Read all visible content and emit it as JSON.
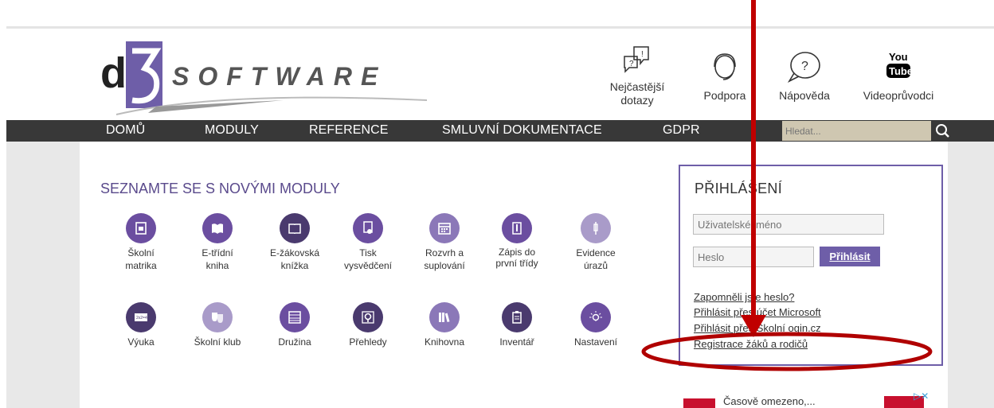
{
  "header": {
    "logo_text": "SOFTWARE",
    "quick_links": [
      {
        "label": "Nejčastější dotazy",
        "icon": "faq-bubbles-icon"
      },
      {
        "label": "Podpora",
        "icon": "headset-icon"
      },
      {
        "label": "Nápověda",
        "icon": "help-bubble-icon"
      },
      {
        "label": "Videoprůvodci",
        "icon": "youtube-icon"
      }
    ]
  },
  "nav": {
    "items": [
      "DOMŮ",
      "MODULY",
      "REFERENCE",
      "SMLUVNÍ DOKUMENTACE",
      "GDPR"
    ],
    "search_placeholder": "Hledat..."
  },
  "modules": {
    "title": "SEZNAMTE SE S NOVÝMI MODULY",
    "row1": [
      {
        "label": "Školní matrika",
        "color": "#6b4ea0"
      },
      {
        "label": "E-třídní kniha",
        "color": "#6b4ea0"
      },
      {
        "label": "E-žákovská knížka",
        "color": "#4a3a6e"
      },
      {
        "label": "Tisk vysvědčení",
        "color": "#6b4ea0"
      },
      {
        "label": "Rozvrh a suplování",
        "color": "#8b78b8"
      },
      {
        "label": "Zápis do první třídy",
        "color": "#6b4ea0"
      },
      {
        "label": "Evidence úrazů",
        "color": "#a99bc9"
      }
    ],
    "row2": [
      {
        "label": "Výuka",
        "color": "#4a3a6e"
      },
      {
        "label": "Školní klub",
        "color": "#a99bc9"
      },
      {
        "label": "Družina",
        "color": "#6b4ea0"
      },
      {
        "label": "Přehledy",
        "color": "#4a3a6e"
      },
      {
        "label": "Knihovna",
        "color": "#8b78b8"
      },
      {
        "label": "Inventář",
        "color": "#4a3a6e"
      },
      {
        "label": "Nastavení",
        "color": "#6b4ea0"
      }
    ]
  },
  "login": {
    "title": "PŘIHLÁŠENÍ",
    "username_placeholder": "Uživatelské jméno",
    "password_placeholder": "Heslo",
    "button": "Přihlásit",
    "links": [
      "Zapomněli jste heslo?",
      "Přihlásit přes účet Microsoft",
      "Přihlásit přes Školní ogin.cz",
      "Registrace žáků a rodičů"
    ]
  },
  "ad": {
    "text": "Časově omezeno,..."
  },
  "colors": {
    "accent": "#6e5ea8",
    "navbar": "#383838",
    "annotation": "#c00000"
  }
}
